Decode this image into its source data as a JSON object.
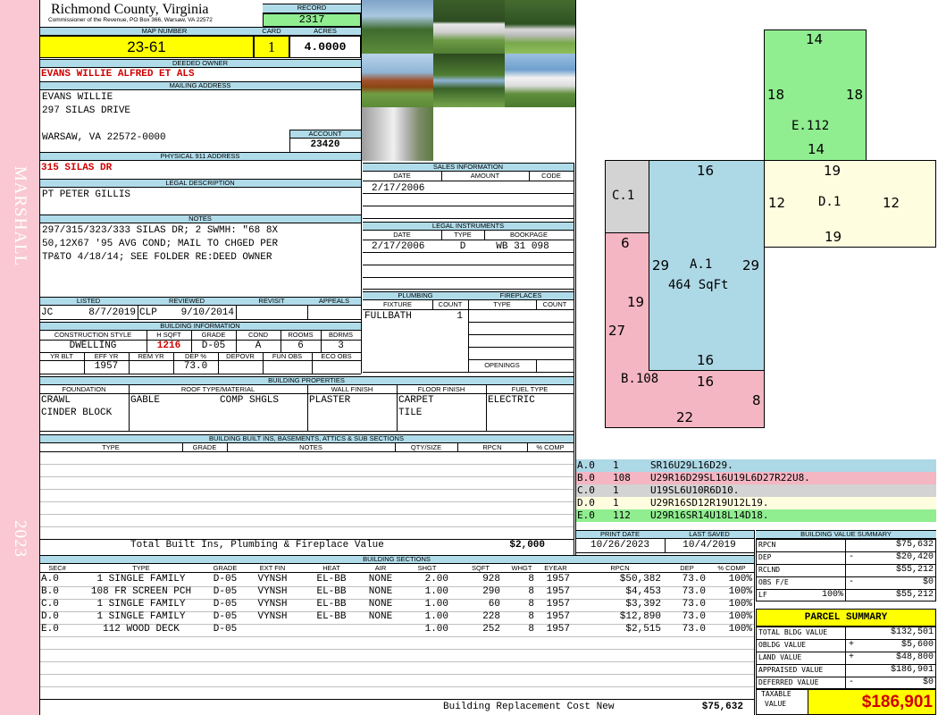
{
  "sidebar": {
    "district": "MARSHALL",
    "year": "2023"
  },
  "header": {
    "county": "Richmond County, Virginia",
    "commissioner": "Commissioner of the Revenue, PO Box 366, Warsaw, VA 22572"
  },
  "record": {
    "label": "RECORD",
    "value": "2317"
  },
  "map": {
    "label": "MAP NUMBER",
    "value": "23-61"
  },
  "card": {
    "label": "CARD",
    "value": "1"
  },
  "acres": {
    "label": "ACRES",
    "value": "4.0000"
  },
  "owner": {
    "label": "DEEDED OWNER",
    "value": "EVANS WILLIE ALFRED ET ALS"
  },
  "mailing": {
    "label": "MAILING ADDRESS",
    "line1": "EVANS WILLIE",
    "line2": "297 SILAS DRIVE",
    "line3": "WARSAW, VA 22572-0000"
  },
  "account": {
    "label": "ACCOUNT",
    "value": "23420"
  },
  "physical": {
    "label": "PHYSICAL 911 ADDRESS",
    "value": "315 SILAS DR"
  },
  "legal": {
    "label": "LEGAL DESCRIPTION",
    "value": "PT PETER GILLIS"
  },
  "notes": {
    "label": "NOTES",
    "line1": "297/315/323/333 SILAS DR; 2 SWMH: \"68 8X",
    "line2": "50,12X67 '95 AVG COND; MAIL TO CHGED PER",
    "line3": "TP&TO 4/18/14; SEE FOLDER RE:DEED OWNER"
  },
  "listed": {
    "h_listed": "LISTED",
    "h_reviewed": "REVIEWED",
    "h_revisit": "REVISIT",
    "h_appeals": "APPEALS",
    "by": "JC",
    "date": "8/7/2019",
    "rev_by": "CLP",
    "rev_date": "9/10/2014"
  },
  "building": {
    "label": "BUILDING INFORMATION",
    "h_style": "CONSTRUCTION STYLE",
    "h_sqft": "H SQFT",
    "h_grade": "GRADE",
    "h_cond": "COND",
    "h_rooms": "ROOMS",
    "h_bdrms": "BDRMS",
    "style": "DWELLING",
    "sqft": "1216",
    "grade": "D-05",
    "cond": "A",
    "rooms": "6",
    "bdrms": "3",
    "h_yrblt": "YR BLT",
    "h_effyr": "EFF YR",
    "h_remyr": "REM YR",
    "h_dep": "DEP %",
    "h_depovr": "DEPOVR",
    "h_funobs": "FUN OBS",
    "h_ecoobs": "ECO OBS",
    "effyr": "1957",
    "dep": "73.0"
  },
  "sales": {
    "label": "SALES INFORMATION",
    "h_date": "DATE",
    "h_amount": "AMOUNT",
    "h_code": "CODE",
    "date": "2/17/2006"
  },
  "instruments": {
    "label": "LEGAL INSTRUMENTS",
    "h_date": "DATE",
    "h_type": "TYPE",
    "h_book": "BOOKPAGE",
    "date": "2/17/2006",
    "type": "D",
    "book": "WB 31 098"
  },
  "plumbing": {
    "label": "PLUMBING",
    "h_fixture": "FIXTURE",
    "h_count": "COUNT",
    "fixture": "FULLBATH",
    "count": "1"
  },
  "fireplaces": {
    "label": "FIREPLACES",
    "h_type": "TYPE",
    "h_count": "COUNT",
    "openings": "OPENINGS"
  },
  "properties": {
    "label": "BUILDING PROPERTIES",
    "h_foundation": "FOUNDATION",
    "h_roof": "ROOF TYPE/MATERIAL",
    "h_wall": "WALL FINISH",
    "h_floor": "FLOOR FINISH",
    "h_fuel": "FUEL TYPE",
    "foundation1": "CRAWL",
    "foundation2": "CINDER BLOCK",
    "roof_type": "GABLE",
    "roof_mat": "COMP SHGLS",
    "wall": "PLASTER",
    "floor1": "CARPET",
    "floor2": "TILE",
    "fuel": "ELECTRIC"
  },
  "builtins": {
    "label": "BUILDING BUILT INS, BASEMENTS, ATTICS & SUB SECTIONS",
    "h_type": "TYPE",
    "h_grade": "GRADE",
    "h_notes": "NOTES",
    "h_qty": "QTY/SIZE",
    "h_rpcn": "RPCN",
    "h_comp": "% COMP",
    "total_label": "Total Built Ins, Plumbing & Fireplace Value",
    "total_value": "$2,000"
  },
  "print": {
    "h_print": "PRINT DATE",
    "h_saved": "LAST SAVED",
    "print_date": "10/26/2023",
    "last_saved": "10/4/2019"
  },
  "sections": {
    "label": "BUILDING SECTIONS",
    "headers": [
      "SEC#",
      "TYPE",
      "GRADE",
      "EXT FIN",
      "HEAT",
      "AIR",
      "SHGT",
      "SQFT",
      "WHGT",
      "EYEAR",
      "RPCN",
      "DEP",
      "% COMP"
    ],
    "rows": [
      {
        "sec": "A.0",
        "type": "1 SINGLE FAMILY",
        "grade": "D-05",
        "ext": "VYNSH",
        "heat": "EL-BB",
        "air": "NONE",
        "shgt": "2.00",
        "sqft": "928",
        "whgt": "8",
        "eyear": "1957",
        "rpcn": "$50,382",
        "dep": "73.0",
        "comp": "100%"
      },
      {
        "sec": "B.0",
        "type": "108 FR SCREEN PCH",
        "grade": "D-05",
        "ext": "VYNSH",
        "heat": "EL-BB",
        "air": "NONE",
        "shgt": "1.00",
        "sqft": "290",
        "whgt": "8",
        "eyear": "1957",
        "rpcn": "$4,453",
        "dep": "73.0",
        "comp": "100%"
      },
      {
        "sec": "C.0",
        "type": "1 SINGLE FAMILY",
        "grade": "D-05",
        "ext": "VYNSH",
        "heat": "EL-BB",
        "air": "NONE",
        "shgt": "1.00",
        "sqft": "60",
        "whgt": "8",
        "eyear": "1957",
        "rpcn": "$3,392",
        "dep": "73.0",
        "comp": "100%"
      },
      {
        "sec": "D.0",
        "type": "1 SINGLE FAMILY",
        "grade": "D-05",
        "ext": "VYNSH",
        "heat": "EL-BB",
        "air": "NONE",
        "shgt": "1.00",
        "sqft": "228",
        "whgt": "8",
        "eyear": "1957",
        "rpcn": "$12,890",
        "dep": "73.0",
        "comp": "100%"
      },
      {
        "sec": "E.0",
        "type": "112 WOOD DECK",
        "grade": "D-05",
        "ext": "",
        "heat": "",
        "air": "",
        "shgt": "1.00",
        "sqft": "252",
        "whgt": "8",
        "eyear": "1957",
        "rpcn": "$2,515",
        "dep": "73.0",
        "comp": "100%"
      }
    ],
    "total_label": "Building Replacement Cost New",
    "total_value": "$75,632"
  },
  "sketch": {
    "colors": {
      "A": "#add8e6",
      "B": "#f4b6c2",
      "C": "#d3d3d3",
      "D": "#fffde0",
      "E": "#90ee90"
    },
    "A_label": "A.1",
    "A_sqft": "464 SqFt",
    "A_top": "16",
    "A_left": "29",
    "A_right": "29",
    "A_bottom": "16",
    "B_label": "B.108",
    "B_6": "6",
    "B_19": "19",
    "B_27": "27",
    "B_16": "16",
    "B_8": "8",
    "B_22": "22",
    "C_label": "C.1",
    "D_label": "D.1",
    "D_top": "19",
    "D_left": "12",
    "D_right": "12",
    "D_bottom": "19",
    "E_label": "E.112",
    "E_top": "14",
    "E_left": "18",
    "E_right": "18",
    "E_bottom": "14"
  },
  "legend": [
    {
      "sec": "A.0",
      "code": "1",
      "path": "SR16U29L16D29."
    },
    {
      "sec": "B.0",
      "code": "108",
      "path": "U29R16D29SL16U19L6D27R22U8."
    },
    {
      "sec": "C.0",
      "code": "1",
      "path": "U19SL6U10R6D10."
    },
    {
      "sec": "D.0",
      "code": "1",
      "path": "U29R16SD12R19U12L19."
    },
    {
      "sec": "E.0",
      "code": "112",
      "path": "U29R16SR14U18L14D18."
    }
  ],
  "bvs": {
    "label": "BUILDING VALUE SUMMARY",
    "rpcn_label": "RPCN",
    "rpcn": "$75,632",
    "dep_label": "DEP",
    "dep_sign": "-",
    "dep": "$20,420",
    "rclnd_label": "RCLND",
    "rclnd": "$55,212",
    "obs_label": "OBS F/E",
    "obs_sign": "-",
    "obs": "$0",
    "lf_label": "LF",
    "lf_pct": "100%",
    "lf": "$55,212"
  },
  "parcel": {
    "label": "PARCEL SUMMARY",
    "bldg_label": "TOTAL BLDG VALUE",
    "bldg": "$132,501",
    "obldg_label": "OBLDG VALUE",
    "obldg_sign": "+",
    "obldg": "$5,600",
    "land_label": "LAND VALUE",
    "land_sign": "+",
    "land": "$48,800",
    "appr_label": "APPRAISED VALUE",
    "appr": "$186,901",
    "def_label": "DEFERRED VALUE",
    "def_sign": "-",
    "def": "$0",
    "taxable_label1": "TAXABLE",
    "taxable_label2": "VALUE",
    "taxable": "$186,901"
  }
}
